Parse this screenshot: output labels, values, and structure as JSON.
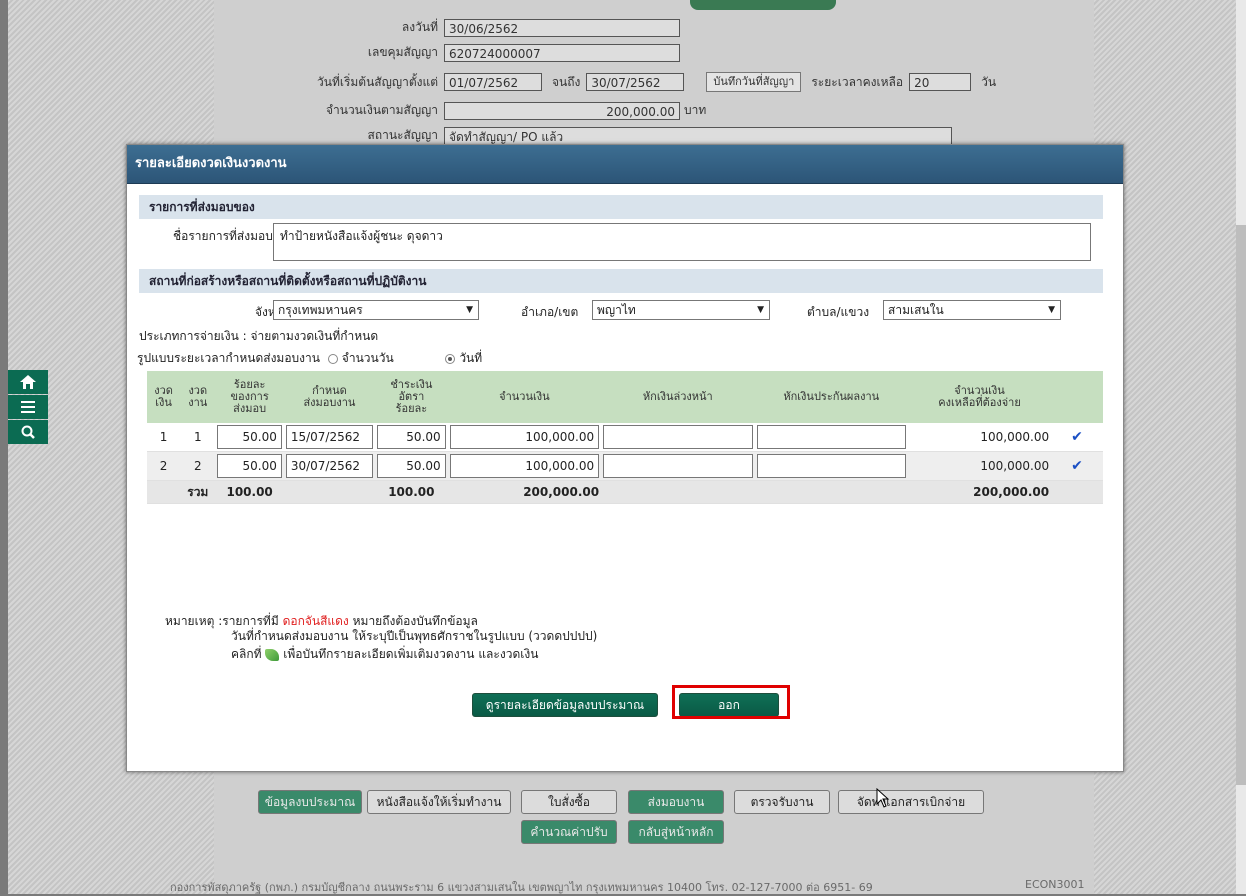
{
  "background_form": {
    "sign_date_label": "ลงวันที่",
    "sign_date": "30/06/2562",
    "contract_no_label": "เลขคุมสัญญา",
    "contract_no": "620724000007",
    "start_label": "วันที่เริ่มต้นสัญญาตั้งแต่",
    "start_date": "01/07/2562",
    "until_label": "จนถึง",
    "end_date": "30/07/2562",
    "save_dates_button": "บันทึกวันที่สัญญา",
    "remaining_label": "ระยะเวลาคงเหลือ",
    "remaining_value": "20",
    "days_unit": "วัน",
    "amount_label": "จำนวนเงินตามสัญญา",
    "amount_value": "200,000.00",
    "baht_unit": "บาท",
    "status_label": "สถานะสัญญา",
    "status_value": "จัดทำสัญญา/ PO แล้ว"
  },
  "sidebar": {
    "home_icon": "home-icon",
    "menu_icon": "menu-icon",
    "search_icon": "search-icon"
  },
  "modal": {
    "title": "รายละเอียดงวดเงินงวดงาน",
    "section_delivery": "รายการที่ส่งมอบของ",
    "delivery_item_label": "ชื่อรายการที่ส่งมอบ",
    "delivery_item_value": "ทำป้ายหนังสือแจ้งผู้ชนะ ดุจดาว",
    "section_location": "สถานที่ก่อสร้างหรือสถานที่ติดตั้งหรือสถานที่ปฏิบัติงาน",
    "province_label": "จังหวัด",
    "province_value": "กรุงเทพมหานคร",
    "district_label": "อำเภอ/เขต",
    "district_value": "พญาไท",
    "subdistrict_label": "ตำบล/แขวง",
    "subdistrict_value": "สามเสนใน",
    "payment_type": "ประเภทการจ่ายเงิน : จ่ายตามงวดเงินที่กำหนด",
    "period_format_label": "รูปแบบระยะเวลากำหนดส่งมอบงาน",
    "radio_days": "จำนวนวัน",
    "radio_date": "วันที่",
    "table": {
      "headers": [
        "งวด\nเงิน",
        "งวด\nงาน",
        "ร้อยละ\nของการ\nส่งมอบ",
        "กำหนด\nส่งมอบงาน",
        "ชำระเงิน\nอัตรา\nร้อยละ",
        "จำนวนเงิน",
        "หักเงินล่วงหน้า",
        "หักเงินประกันผลงาน",
        "จำนวนเงิน\nคงเหลือที่ต้องจ่าย",
        ""
      ],
      "rows": [
        {
          "money_no": "1",
          "work_no": "1",
          "percent": "50.00",
          "due": "15/07/2562",
          "pay_pct": "50.00",
          "amount": "100,000.00",
          "advance": "",
          "guarantee": "",
          "remaining": "100,000.00"
        },
        {
          "money_no": "2",
          "work_no": "2",
          "percent": "50.00",
          "due": "30/07/2562",
          "pay_pct": "50.00",
          "amount": "100,000.00",
          "advance": "",
          "guarantee": "",
          "remaining": "100,000.00"
        }
      ],
      "total_label": "รวม",
      "total_percent": "100.00",
      "total_pay_pct": "100.00",
      "total_amount": "200,000.00",
      "total_remaining": "200,000.00"
    },
    "note_prefix": "หมายเหตุ :รายการที่มี",
    "note_red": "ดอกจันสีแดง",
    "note_suffix": "หมายถึงต้องบันทึกข้อมูล",
    "note_line2": "วันที่กำหนดส่งมอบงาน ให้ระบุปีเป็นพุทธศักราชในรูปแบบ (ววดดปปปป)",
    "note_line3_prefix": "คลิกที่",
    "note_line3_suffix": "เพื่อบันทึกรายละเอียดเพิ่มเติมงวดงาน และงวดเงิน",
    "budget_button": "ดูรายละเอียดข้อมูลงบประมาณ",
    "exit_button": "ออก"
  },
  "footer": {
    "btn_budget": "ข้อมูลงบประมาณ",
    "btn_notify": "หนังสือแจ้งให้เริ่มทำงาน",
    "btn_po": "ใบสั่งซื้อ",
    "btn_deliver": "ส่งมอบงาน",
    "btn_inspect": "ตรวจรับงาน",
    "btn_disburse": "จัดทำเอกสารเบิกจ่าย",
    "btn_fine": "คำนวณค่าปรับ",
    "btn_home": "กลับสู่หน้าหลัก",
    "address": "กองการพัสดุภาครัฐ (กพภ.) กรมบัญชีกลาง ถนนพระราม 6 แขวงสามเสนใน เขตพญาไท กรุงเทพมหานคร 10400 โทร. 02-127-7000 ต่อ 6951- 69",
    "code": "ECON3001"
  }
}
